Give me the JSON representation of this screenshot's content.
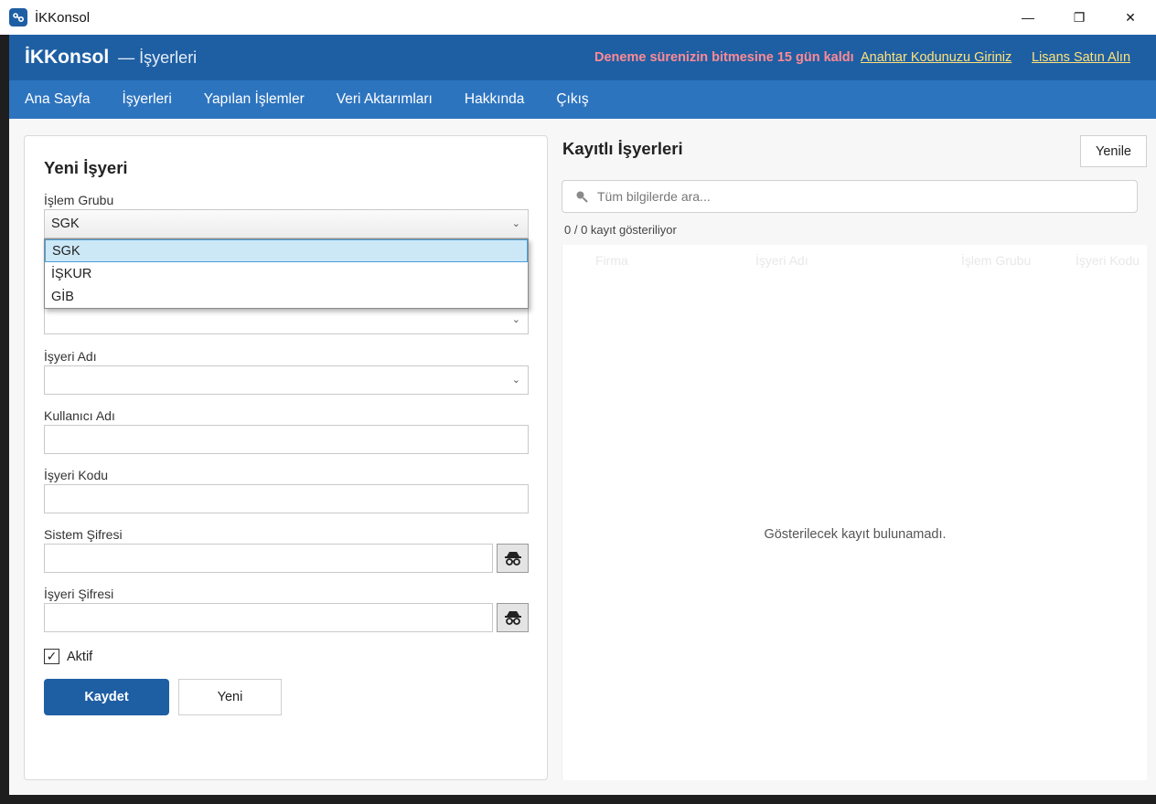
{
  "window": {
    "title": "İKKonsol",
    "controls": {
      "minimize": "—",
      "restore": "❐",
      "close": "✕"
    }
  },
  "header": {
    "brand": "İKKonsol",
    "section": "— İşyerleri",
    "trial_notice": "Deneme sürenizin bitmesine 15 gün kaldı",
    "enter_key_link": "Anahtar Kodunuzu Giriniz",
    "buy_license_link": "Lisans Satın Alın"
  },
  "nav": {
    "items": [
      "Ana Sayfa",
      "İşyerleri",
      "Yapılan İşlemler",
      "Veri Aktarımları",
      "Hakkında",
      "Çıkış"
    ]
  },
  "form": {
    "title": "Yeni İşyeri",
    "islem_grubu": {
      "label": "İşlem Grubu",
      "value": "SGK",
      "options": [
        "SGK",
        "İŞKUR",
        "GİB"
      ],
      "selected_index": 0
    },
    "firma": {
      "value": ""
    },
    "isyeri_adi": {
      "label": "İşyeri Adı",
      "value": ""
    },
    "kullanici_adi": {
      "label": "Kullanıcı Adı",
      "value": ""
    },
    "isyeri_kodu": {
      "label": "İşyeri Kodu",
      "value": ""
    },
    "sistem_sifresi": {
      "label": "Sistem Şifresi",
      "value": ""
    },
    "isyeri_sifresi": {
      "label": "İşyeri Şifresi",
      "value": ""
    },
    "aktif": {
      "label": "Aktif",
      "checked": true,
      "mark": "✓"
    },
    "save_label": "Kaydet",
    "new_label": "Yeni"
  },
  "list": {
    "title": "Kayıtlı İşyerleri",
    "refresh_label": "Yenile",
    "search_placeholder": "Tüm bilgilerde ara...",
    "count_text": "0 / 0 kayıt gösteriliyor",
    "columns": [
      "Firma",
      "İşyeri Adı",
      "İşlem Grubu",
      "İşyeri Kodu"
    ],
    "empty_text": "Gösterilecek kayıt bulunamadı."
  },
  "colors": {
    "header_bg": "#1e5fa3",
    "nav_bg": "#2d74bf",
    "trial_text": "#ff8a95",
    "link_text": "#ffe27a",
    "primary_button": "#1e5fa3"
  }
}
